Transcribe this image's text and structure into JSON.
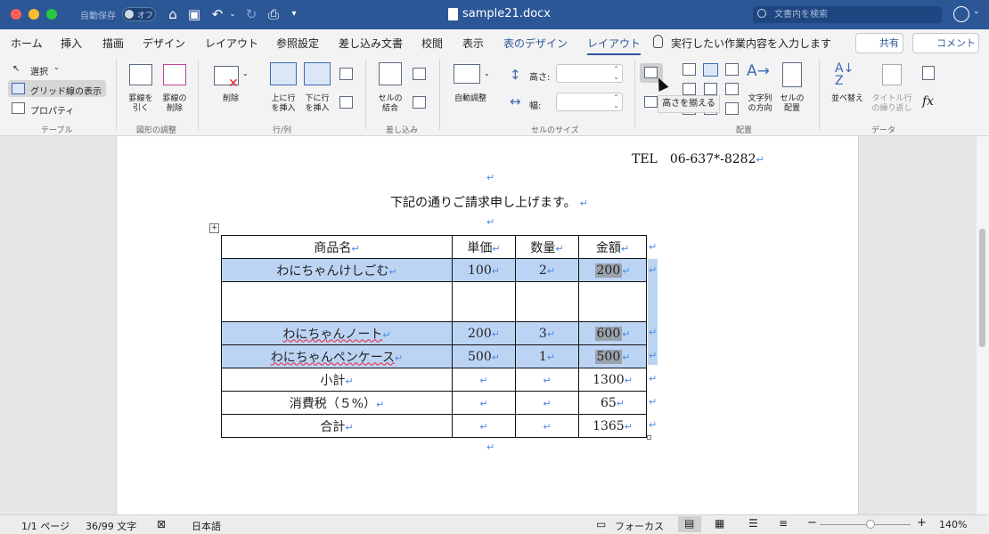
{
  "titlebar": {
    "autosave_label": "自動保存",
    "autosave_state": "オフ",
    "document_title": "sample21.docx",
    "search_placeholder": "文書内を検索"
  },
  "tabs": [
    {
      "label": "ホーム"
    },
    {
      "label": "挿入"
    },
    {
      "label": "描画"
    },
    {
      "label": "デザイン"
    },
    {
      "label": "レイアウト"
    },
    {
      "label": "参照設定"
    },
    {
      "label": "差し込み文書"
    },
    {
      "label": "校閲"
    },
    {
      "label": "表示"
    },
    {
      "label": "表のデザイン"
    },
    {
      "label": "レイアウト"
    }
  ],
  "tell_me": "実行したい作業内容を入力します",
  "share_label": "共有",
  "comment_label": "コメント",
  "ribbon": {
    "table_group": {
      "label": "テーブル",
      "select": "選択",
      "gridlines": "グリッド線の表示",
      "properties": "プロパティ"
    },
    "draw_group": {
      "label": "図形の調整",
      "draw_line_1": "罫線を",
      "draw_line_2": "引く",
      "erase_line_1": "罫線の",
      "erase_line_2": "削除"
    },
    "rowcol_group": {
      "label": "行/列",
      "delete": "削除",
      "insert_above_1": "上に行",
      "insert_above_2": "を挿入",
      "insert_below_1": "下に行",
      "insert_below_2": "を挿入"
    },
    "merge_group": {
      "label": "差し込み",
      "merge_1": "セルの",
      "merge_2": "結合"
    },
    "cellsize_group": {
      "label": "セルのサイズ",
      "autofit": "自動調整",
      "height_label": "高さ:",
      "width_label": "幅:"
    },
    "tooltip": "高さを揃える",
    "align_group": {
      "label": "配置",
      "text_dir_1": "文字列",
      "text_dir_2": "の方向",
      "cell_margin_1": "セルの",
      "cell_margin_2": "配置"
    },
    "data_group": {
      "label": "データ",
      "sort": "並べ替え",
      "repeat_1": "タイトル行",
      "repeat_2": "の繰り返し",
      "formula": "fx"
    }
  },
  "document": {
    "tel_line": "TEL　06-637*-8282",
    "intro": "下記の通りご請求申し上げます。",
    "return_mark": "↵",
    "table": {
      "headers": [
        "商品名",
        "単価",
        "数量",
        "金額"
      ],
      "rows": [
        [
          "わにちゃんけしごむ",
          "100",
          "2",
          "200"
        ],
        [
          "",
          "",
          "",
          ""
        ],
        [
          "わにちゃんノート",
          "200",
          "3",
          "600"
        ],
        [
          "わにちゃんペンケース",
          "500",
          "1",
          "500"
        ],
        [
          "小計",
          "",
          "",
          "1300"
        ],
        [
          "消費税（５%）",
          "",
          "",
          "65"
        ],
        [
          "合計",
          "",
          "",
          "1365"
        ]
      ]
    }
  },
  "statusbar": {
    "page": "1/1 ページ",
    "words": "36/99 文字",
    "language": "日本語",
    "focus": "フォーカス",
    "zoom": "140%"
  },
  "colors": {
    "title_bar": "#2b5797",
    "selection": "#bcd4f4",
    "accent": "#2b5797"
  }
}
